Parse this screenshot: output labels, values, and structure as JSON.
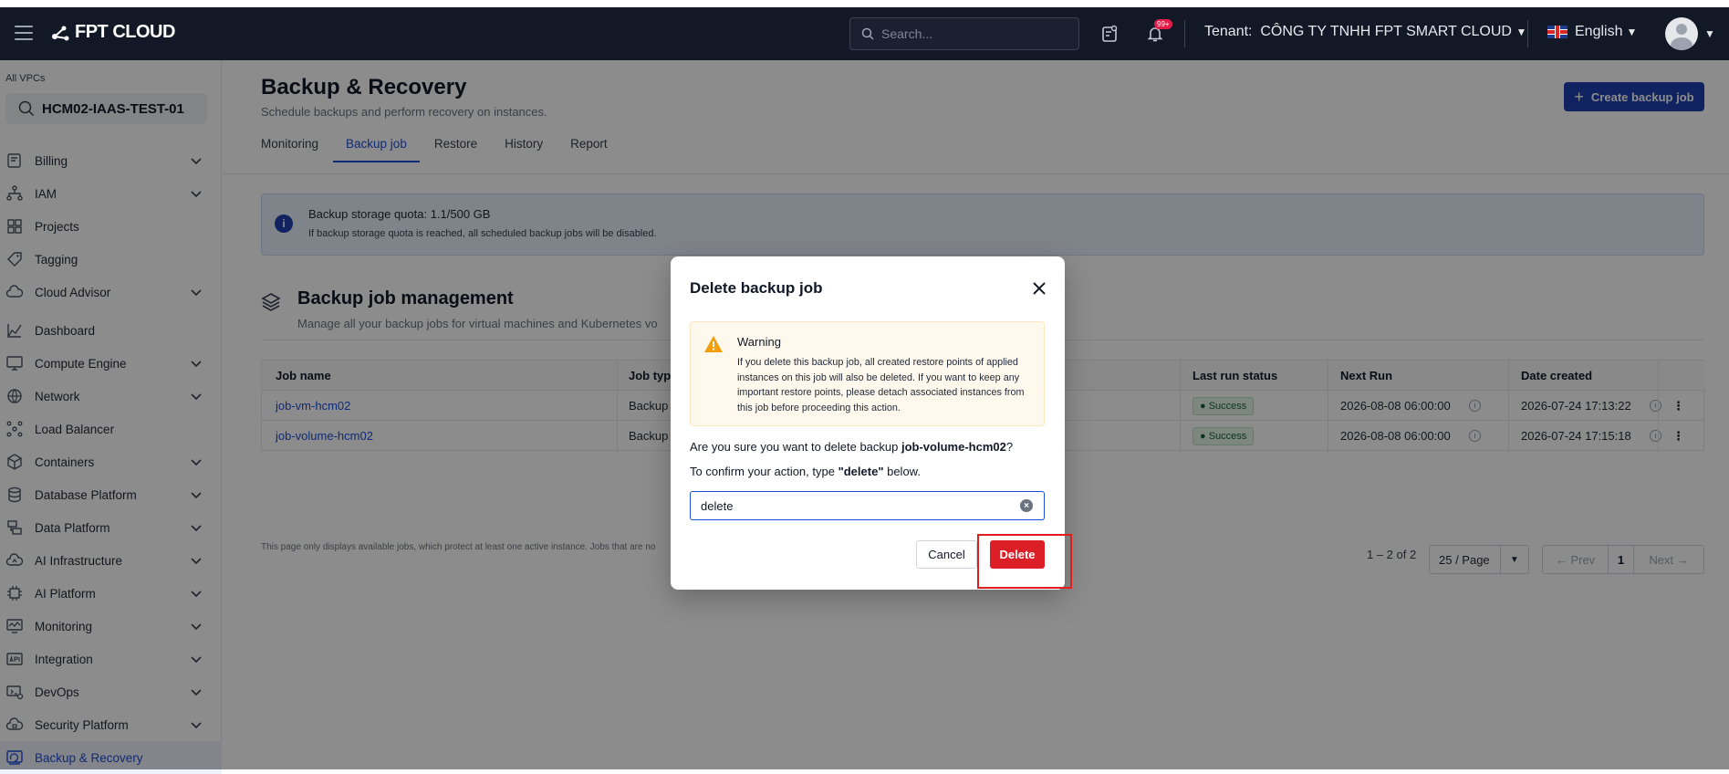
{
  "topbar": {
    "brand": "FPT CLOUD",
    "search_placeholder": "Search...",
    "notification_badge": "99+",
    "tenant_label": "Tenant:",
    "tenant_name": "CÔNG TY TNHH FPT SMART CLOUD",
    "language": "English"
  },
  "sidebar": {
    "vpc_label": "All VPCs",
    "vpc_value": "HCM02-IAAS-TEST-01",
    "items": [
      {
        "label": "Billing",
        "icon": "billing-icon",
        "has_chevron": true
      },
      {
        "label": "IAM",
        "icon": "iam-icon",
        "has_chevron": true
      },
      {
        "label": "Projects",
        "icon": "projects-icon",
        "has_chevron": false
      },
      {
        "label": "Tagging",
        "icon": "tag-icon",
        "has_chevron": false
      },
      {
        "label": "Cloud Advisor",
        "icon": "cloud-icon",
        "has_chevron": true
      },
      {
        "label": "Dashboard",
        "icon": "dashboard-icon",
        "has_chevron": false
      },
      {
        "label": "Compute Engine",
        "icon": "monitor-icon",
        "has_chevron": true
      },
      {
        "label": "Network",
        "icon": "globe-icon",
        "has_chevron": true
      },
      {
        "label": "Load Balancer",
        "icon": "load-balancer-icon",
        "has_chevron": false
      },
      {
        "label": "Containers",
        "icon": "cube-icon",
        "has_chevron": true
      },
      {
        "label": "Database Platform",
        "icon": "database-icon",
        "has_chevron": true
      },
      {
        "label": "Data Platform",
        "icon": "data-platform-icon",
        "has_chevron": true
      },
      {
        "label": "AI Infrastructure",
        "icon": "ai-infra-icon",
        "has_chevron": true
      },
      {
        "label": "AI Platform",
        "icon": "ai-chip-icon",
        "has_chevron": true
      },
      {
        "label": "Monitoring",
        "icon": "monitoring-icon",
        "has_chevron": true
      },
      {
        "label": "Integration",
        "icon": "api-icon",
        "has_chevron": true
      },
      {
        "label": "DevOps",
        "icon": "devops-icon",
        "has_chevron": true
      },
      {
        "label": "Security Platform",
        "icon": "security-icon",
        "has_chevron": true
      },
      {
        "label": "Backup & Recovery",
        "icon": "backup-icon",
        "has_chevron": false,
        "active": true
      }
    ]
  },
  "page": {
    "title": "Backup & Recovery",
    "subtitle": "Schedule backups and perform recovery on instances.",
    "create_button": "Create backup job",
    "tabs": [
      "Monitoring",
      "Backup job",
      "Restore",
      "History",
      "Report"
    ],
    "active_tab": "Backup job"
  },
  "info": {
    "title": "Backup storage quota: 1.1/500 GB",
    "body": "If backup storage quota is reached, all scheduled backup jobs will be disabled."
  },
  "section": {
    "title": "Backup job management",
    "subtitle": "Manage all your backup jobs for virtual machines and Kubernetes vo"
  },
  "table": {
    "headers": [
      "Job name",
      "Job typ",
      "Last run status",
      "Next Run",
      "Date created"
    ],
    "rows": [
      {
        "name": "job-vm-hcm02",
        "type": "Backup",
        "status": "Success",
        "next_run": "2026-08-08 06:00:00",
        "created": "2026-07-24 17:13:22"
      },
      {
        "name": "job-volume-hcm02",
        "type": "Backup",
        "status": "Success",
        "next_run": "2026-08-08 06:00:00",
        "created": "2026-07-24 17:15:18"
      }
    ]
  },
  "pagination": {
    "range": "1 – 2 of 2",
    "page_size": "25 / Page",
    "prev": "Prev",
    "current": "1",
    "next": "Next"
  },
  "footnote": "This page only displays available jobs, which protect at least one active instance. Jobs that are no",
  "modal": {
    "title": "Delete backup job",
    "warning_title": "Warning",
    "warning_body": "If you delete this backup job, all created restore points of applied instances on this job will also be deleted. If you want to keep any important restore points, please detach associated instances from this job before proceeding this action.",
    "question_prefix": "Are you sure you want to delete backup ",
    "question_target": "job-volume-hcm02",
    "question_suffix": "?",
    "confirm_prefix": "To confirm your action, type ",
    "confirm_keyword": "\"delete\"",
    "confirm_suffix": " below.",
    "input_value": "delete",
    "cancel": "Cancel",
    "delete": "Delete"
  },
  "colors": {
    "topbar": "#121826",
    "primary": "#1e40af",
    "danger": "#dc1f26",
    "highlight": "#e11d1d"
  }
}
